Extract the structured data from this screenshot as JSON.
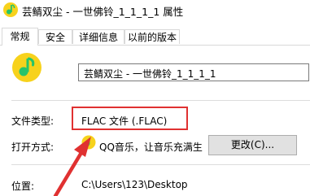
{
  "window": {
    "title": "芸鲭双尘 - 一世佛铃_1_1_1_1 属性"
  },
  "tabs": [
    {
      "label": "常规"
    },
    {
      "label": "安全"
    },
    {
      "label": "详细信息"
    },
    {
      "label": "以前的版本"
    }
  ],
  "general": {
    "file_name": "芸鲭双尘 - 一世佛铃_1_1_1_1",
    "type_label": "文件类型:",
    "type_value": "FLAC 文件 (.FLAC)",
    "open_label": "打开方式:",
    "open_value": "QQ音乐，让音乐充满生",
    "change_button": "更改(C)...",
    "location_label": "位置:",
    "location_value": "C:\\Users\\123\\Desktop"
  },
  "colors": {
    "highlight": "#e03131",
    "qq_music_yellow": "#f7d21c",
    "qq_music_green": "#27c36a"
  },
  "icons": {
    "title": "qq-music-icon",
    "app": "qq-music-icon",
    "open_with": "qq-music-icon"
  }
}
